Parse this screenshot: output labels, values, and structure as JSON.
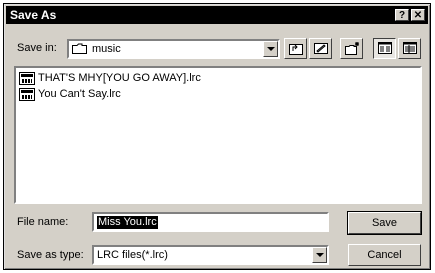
{
  "dialog": {
    "title": "Save As",
    "help_button": "?",
    "close_button": "✕"
  },
  "toolbar": {
    "save_in_label": "Save in:",
    "save_in_value": "music"
  },
  "files": [
    {
      "name": "THAT'S MHY[YOU GO AWAY].lrc"
    },
    {
      "name": "You Can't Say.lrc"
    }
  ],
  "form": {
    "file_name_label": "File name:",
    "file_name_value": "Miss You.lrc",
    "save_as_type_label": "Save as type:",
    "save_as_type_value": "LRC files(*.lrc)"
  },
  "buttons": {
    "save": "Save",
    "cancel": "Cancel"
  }
}
